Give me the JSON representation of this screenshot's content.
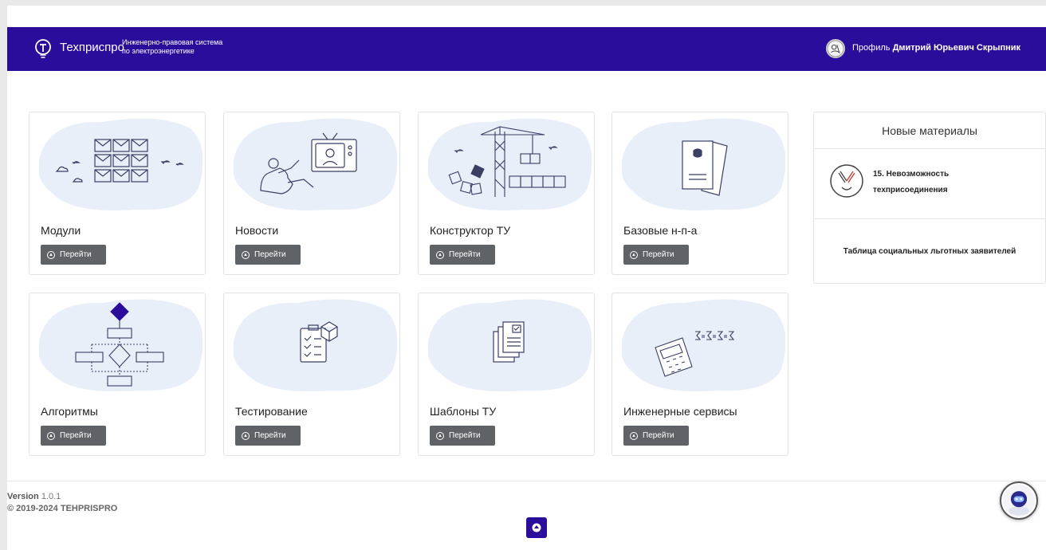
{
  "header": {
    "brand": "Техприспро",
    "tagline_line1": "Инженерно-правовая система",
    "tagline_line2": "по электроэнергетике",
    "profile_prefix": "Профиль",
    "profile_name": "Дмитрий Юрьевич Скрыпник",
    "bg_color": "#2a0d9a"
  },
  "cards": [
    {
      "title": "Модули",
      "button": "Перейти",
      "icon": "modules-grid-illustration"
    },
    {
      "title": "Новости",
      "button": "Перейти",
      "icon": "news-tv-illustration"
    },
    {
      "title": "Конструктор ТУ",
      "button": "Перейти",
      "icon": "construction-crane-illustration"
    },
    {
      "title": "Базовые н-п-а",
      "button": "Перейти",
      "icon": "legal-documents-illustration"
    },
    {
      "title": "Алгоритмы",
      "button": "Перейти",
      "icon": "flowchart-illustration"
    },
    {
      "title": "Тестирование",
      "button": "Перейти",
      "icon": "checklist-illustration"
    },
    {
      "title": "Шаблоны ТУ",
      "button": "Перейти",
      "icon": "template-documents-illustration"
    },
    {
      "title": "Инженерные сервисы",
      "button": "Перейти",
      "icon": "calculator-formula-illustration"
    }
  ],
  "materials": {
    "title": "Новые материалы",
    "items": [
      {
        "label": "15. Невозможность техприсоединения",
        "icon": "no-connection-icon"
      },
      {
        "label": "Таблица социальных льготных заявителей"
      }
    ]
  },
  "footer": {
    "version_label": "Version",
    "version_value": "1.0.1",
    "copyright": "© 2019-2024 TEHPRISPRO"
  }
}
